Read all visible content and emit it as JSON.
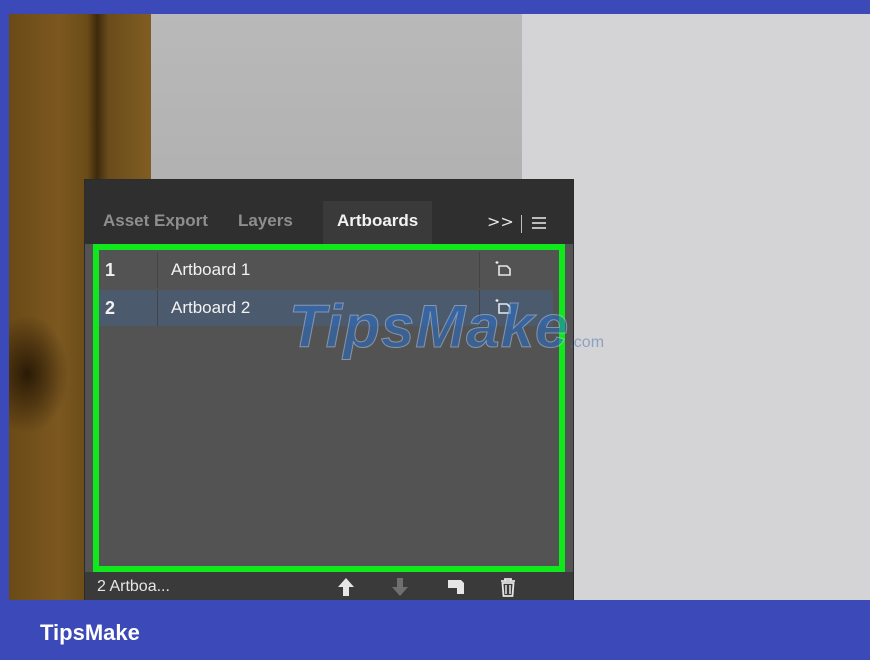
{
  "panel": {
    "tabs": [
      {
        "label": "Asset Export",
        "active": false
      },
      {
        "label": "Layers",
        "active": false
      },
      {
        "label": "Artboards",
        "active": true
      }
    ],
    "more_label": ">>",
    "menu_icon": "hamburger-menu-icon"
  },
  "artboards": {
    "rows": [
      {
        "number": "1",
        "name": "Artboard 1",
        "selected": false,
        "option_icon": "artboard-options-icon"
      },
      {
        "number": "2",
        "name": "Artboard 2",
        "selected": true,
        "option_icon": "artboard-options-icon"
      }
    ]
  },
  "footer": {
    "count_label": "2 Artboa...",
    "buttons": [
      {
        "name": "move-up",
        "icon": "arrow-up-icon",
        "enabled": true
      },
      {
        "name": "move-down",
        "icon": "arrow-down-icon",
        "enabled": false
      },
      {
        "name": "new-artboard",
        "icon": "new-artboard-icon",
        "enabled": true
      },
      {
        "name": "delete-artboard",
        "icon": "trash-icon",
        "enabled": true
      }
    ]
  },
  "highlight": {
    "color": "#0fe81a"
  },
  "watermark": {
    "text": "TipsMake",
    "suffix": ".com"
  },
  "brand": {
    "label": "TipsMake"
  },
  "colors": {
    "frame_background": "#3c49b8",
    "panel_background": "#535353",
    "tabbar_background": "#2f2f2f",
    "selected_row": "#4c5a6e"
  }
}
